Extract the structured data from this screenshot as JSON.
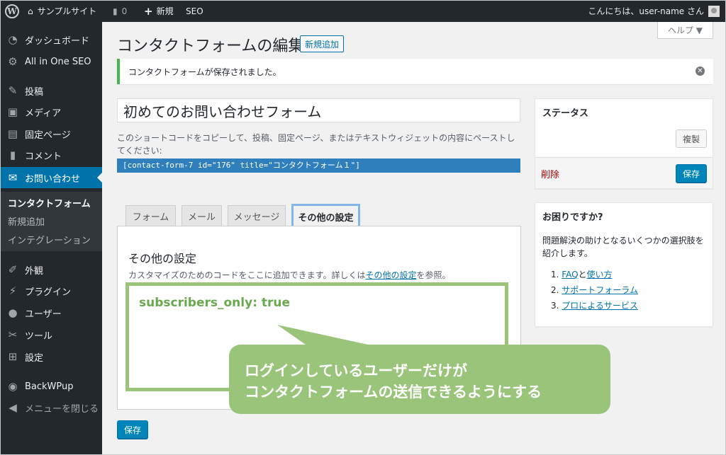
{
  "adminbar": {
    "site_name": "サンプルサイト",
    "comments_count": "0",
    "new_label": "新規",
    "seo_label": "SEO",
    "greeting": "こんにちは、user-name さん"
  },
  "sidebar": {
    "items": [
      {
        "label": "ダッシュボード",
        "icon": "dashboard-icon"
      },
      {
        "label": "All in One SEO",
        "icon": "gear-icon"
      },
      {
        "label": "投稿",
        "icon": "pin-icon"
      },
      {
        "label": "メディア",
        "icon": "media-icon"
      },
      {
        "label": "固定ページ",
        "icon": "page-icon"
      },
      {
        "label": "コメント",
        "icon": "comment-icon"
      },
      {
        "label": "お問い合わせ",
        "icon": "mail-icon"
      },
      {
        "label": "外観",
        "icon": "brush-icon"
      },
      {
        "label": "プラグイン",
        "icon": "plugin-icon"
      },
      {
        "label": "ユーザー",
        "icon": "user-icon"
      },
      {
        "label": "ツール",
        "icon": "wrench-icon"
      },
      {
        "label": "設定",
        "icon": "settings-icon"
      },
      {
        "label": "BackWPup",
        "icon": "backwpup-icon"
      },
      {
        "label": "メニューを閉じる",
        "icon": "collapse-icon"
      }
    ],
    "submenu": [
      "コンタクトフォーム",
      "新規追加",
      "インテグレーション"
    ]
  },
  "main": {
    "title": "コンタクトフォームの編集",
    "add_new": "新規追加",
    "help": "ヘルプ ▼",
    "notice": "コンタクトフォームが保存されました。",
    "form_title": "初めてのお問い合わせフォーム",
    "shortcode_desc": "このショートコードをコピーして、投稿、固定ページ、またはテキストウィジェットの内容にペーストしてください:",
    "shortcode": "[contact-form-7 id=\"176\" title=\"コンタクトフォーム１\"]",
    "tabs": [
      "フォーム",
      "メール",
      "メッセージ",
      "その他の設定"
    ],
    "panel_title": "その他の設定",
    "panel_desc_prefix": "カスタマイズのためのコードをここに追加できます。詳しくは",
    "panel_desc_link": "その他の設定",
    "panel_desc_suffix": "を参照。",
    "code": "subscribers_only: true",
    "save": "保存"
  },
  "callout": {
    "line1": "ログインしているユーザーだけが",
    "line2": "コンタクトフォームの送信できるようにする"
  },
  "status_box": {
    "title": "ステータス",
    "duplicate": "複製",
    "delete": "削除",
    "save": "保存"
  },
  "help_box": {
    "title": "お困りですか?",
    "desc": "問題解決の助けとなるいくつかの選択肢を紹介します。",
    "items": [
      {
        "num": "1.",
        "link": "FAQ",
        "mid": "と",
        "link2": "使い方"
      },
      {
        "num": "2.",
        "link": "サポートフォーラム"
      },
      {
        "num": "3.",
        "link": "プロによるサービス"
      }
    ]
  },
  "colors": {
    "adminbar": "#23282d",
    "accent": "#0073aa",
    "notice_border": "#46b450",
    "callout": "#99c47a",
    "code_text": "#6aa84f",
    "delete": "#aa0000"
  }
}
